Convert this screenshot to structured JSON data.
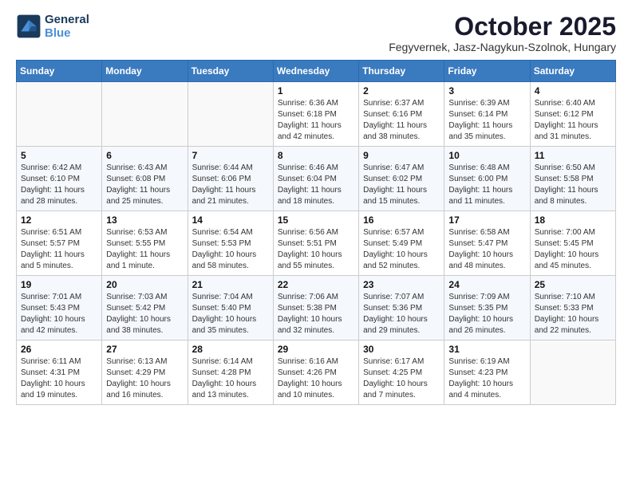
{
  "logo": {
    "line1": "General",
    "line2": "Blue"
  },
  "title": "October 2025",
  "subtitle": "Fegyvernek, Jasz-Nagykun-Szolnok, Hungary",
  "days_of_week": [
    "Sunday",
    "Monday",
    "Tuesday",
    "Wednesday",
    "Thursday",
    "Friday",
    "Saturday"
  ],
  "weeks": [
    [
      {
        "day": "",
        "info": ""
      },
      {
        "day": "",
        "info": ""
      },
      {
        "day": "",
        "info": ""
      },
      {
        "day": "1",
        "info": "Sunrise: 6:36 AM\nSunset: 6:18 PM\nDaylight: 11 hours\nand 42 minutes."
      },
      {
        "day": "2",
        "info": "Sunrise: 6:37 AM\nSunset: 6:16 PM\nDaylight: 11 hours\nand 38 minutes."
      },
      {
        "day": "3",
        "info": "Sunrise: 6:39 AM\nSunset: 6:14 PM\nDaylight: 11 hours\nand 35 minutes."
      },
      {
        "day": "4",
        "info": "Sunrise: 6:40 AM\nSunset: 6:12 PM\nDaylight: 11 hours\nand 31 minutes."
      }
    ],
    [
      {
        "day": "5",
        "info": "Sunrise: 6:42 AM\nSunset: 6:10 PM\nDaylight: 11 hours\nand 28 minutes."
      },
      {
        "day": "6",
        "info": "Sunrise: 6:43 AM\nSunset: 6:08 PM\nDaylight: 11 hours\nand 25 minutes."
      },
      {
        "day": "7",
        "info": "Sunrise: 6:44 AM\nSunset: 6:06 PM\nDaylight: 11 hours\nand 21 minutes."
      },
      {
        "day": "8",
        "info": "Sunrise: 6:46 AM\nSunset: 6:04 PM\nDaylight: 11 hours\nand 18 minutes."
      },
      {
        "day": "9",
        "info": "Sunrise: 6:47 AM\nSunset: 6:02 PM\nDaylight: 11 hours\nand 15 minutes."
      },
      {
        "day": "10",
        "info": "Sunrise: 6:48 AM\nSunset: 6:00 PM\nDaylight: 11 hours\nand 11 minutes."
      },
      {
        "day": "11",
        "info": "Sunrise: 6:50 AM\nSunset: 5:58 PM\nDaylight: 11 hours\nand 8 minutes."
      }
    ],
    [
      {
        "day": "12",
        "info": "Sunrise: 6:51 AM\nSunset: 5:57 PM\nDaylight: 11 hours\nand 5 minutes."
      },
      {
        "day": "13",
        "info": "Sunrise: 6:53 AM\nSunset: 5:55 PM\nDaylight: 11 hours\nand 1 minute."
      },
      {
        "day": "14",
        "info": "Sunrise: 6:54 AM\nSunset: 5:53 PM\nDaylight: 10 hours\nand 58 minutes."
      },
      {
        "day": "15",
        "info": "Sunrise: 6:56 AM\nSunset: 5:51 PM\nDaylight: 10 hours\nand 55 minutes."
      },
      {
        "day": "16",
        "info": "Sunrise: 6:57 AM\nSunset: 5:49 PM\nDaylight: 10 hours\nand 52 minutes."
      },
      {
        "day": "17",
        "info": "Sunrise: 6:58 AM\nSunset: 5:47 PM\nDaylight: 10 hours\nand 48 minutes."
      },
      {
        "day": "18",
        "info": "Sunrise: 7:00 AM\nSunset: 5:45 PM\nDaylight: 10 hours\nand 45 minutes."
      }
    ],
    [
      {
        "day": "19",
        "info": "Sunrise: 7:01 AM\nSunset: 5:43 PM\nDaylight: 10 hours\nand 42 minutes."
      },
      {
        "day": "20",
        "info": "Sunrise: 7:03 AM\nSunset: 5:42 PM\nDaylight: 10 hours\nand 38 minutes."
      },
      {
        "day": "21",
        "info": "Sunrise: 7:04 AM\nSunset: 5:40 PM\nDaylight: 10 hours\nand 35 minutes."
      },
      {
        "day": "22",
        "info": "Sunrise: 7:06 AM\nSunset: 5:38 PM\nDaylight: 10 hours\nand 32 minutes."
      },
      {
        "day": "23",
        "info": "Sunrise: 7:07 AM\nSunset: 5:36 PM\nDaylight: 10 hours\nand 29 minutes."
      },
      {
        "day": "24",
        "info": "Sunrise: 7:09 AM\nSunset: 5:35 PM\nDaylight: 10 hours\nand 26 minutes."
      },
      {
        "day": "25",
        "info": "Sunrise: 7:10 AM\nSunset: 5:33 PM\nDaylight: 10 hours\nand 22 minutes."
      }
    ],
    [
      {
        "day": "26",
        "info": "Sunrise: 6:11 AM\nSunset: 4:31 PM\nDaylight: 10 hours\nand 19 minutes."
      },
      {
        "day": "27",
        "info": "Sunrise: 6:13 AM\nSunset: 4:29 PM\nDaylight: 10 hours\nand 16 minutes."
      },
      {
        "day": "28",
        "info": "Sunrise: 6:14 AM\nSunset: 4:28 PM\nDaylight: 10 hours\nand 13 minutes."
      },
      {
        "day": "29",
        "info": "Sunrise: 6:16 AM\nSunset: 4:26 PM\nDaylight: 10 hours\nand 10 minutes."
      },
      {
        "day": "30",
        "info": "Sunrise: 6:17 AM\nSunset: 4:25 PM\nDaylight: 10 hours\nand 7 minutes."
      },
      {
        "day": "31",
        "info": "Sunrise: 6:19 AM\nSunset: 4:23 PM\nDaylight: 10 hours\nand 4 minutes."
      },
      {
        "day": "",
        "info": ""
      }
    ]
  ]
}
